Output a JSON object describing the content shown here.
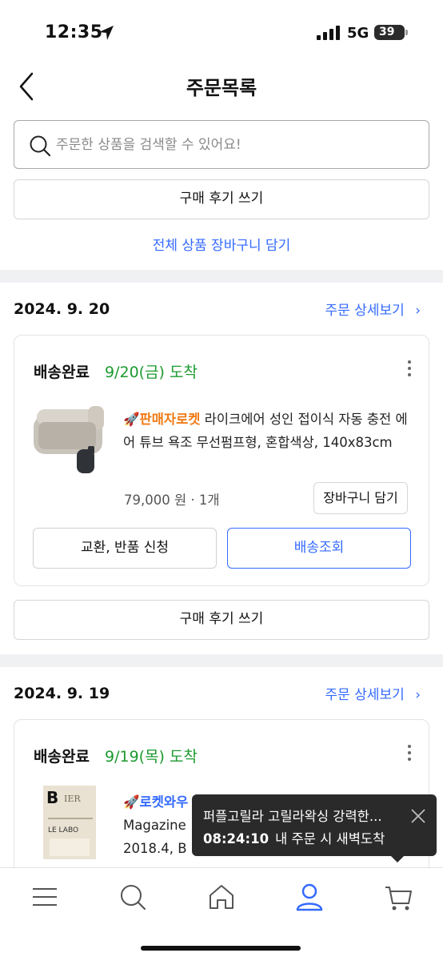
{
  "status_bar": {
    "time": "12:35",
    "network": "5G",
    "battery": "39",
    "battery_level": 0.39
  },
  "header": {
    "title": "주문목록"
  },
  "search": {
    "placeholder": "주문한 상품을 검색할 수 있어요!",
    "value": ""
  },
  "top_actions": {
    "review_label": "구매 후기 쓰기",
    "add_all_to_cart": "전체 상품 장바구니 담기"
  },
  "orders": [
    {
      "date": "2024. 9. 20",
      "detail_link": "주문 상세보기",
      "status": "배송완료",
      "arrival": "9/20(금) 도착",
      "badge": "판매자로켓",
      "product_name": "라이크에어 성인 접이식 자동 충전 에어 튜브 욕조 무선펌프형, 혼합색상, 140x83cm",
      "price": "79,000 원",
      "quantity": "1개",
      "cart_button": "장바구니 담기",
      "exchange_button": "교환, 반품 신청",
      "tracking_button": "배송조회",
      "review_button": "구매 후기 쓰기"
    },
    {
      "date": "2024. 9. 19",
      "detail_link": "주문 상세보기",
      "status": "배송완료",
      "arrival": "9/19(목) 도착",
      "badge": "로켓와우",
      "product_name_line1": "Magazine",
      "product_name_line2": "2018.4, B"
    }
  ],
  "toast": {
    "title": "퍼플고릴라 고릴라왁싱 강력한...",
    "timer": "08:24:10",
    "message": "내 주문 시 새벽도착"
  },
  "tab_bar": {
    "items": [
      "menu-icon",
      "search-icon",
      "home-icon",
      "profile-icon",
      "cart-icon"
    ],
    "active": "profile-icon"
  },
  "colors": {
    "accent_blue": "#346aff",
    "arrival_green": "#1d9a2f",
    "rocket_orange": "#f07a14"
  }
}
